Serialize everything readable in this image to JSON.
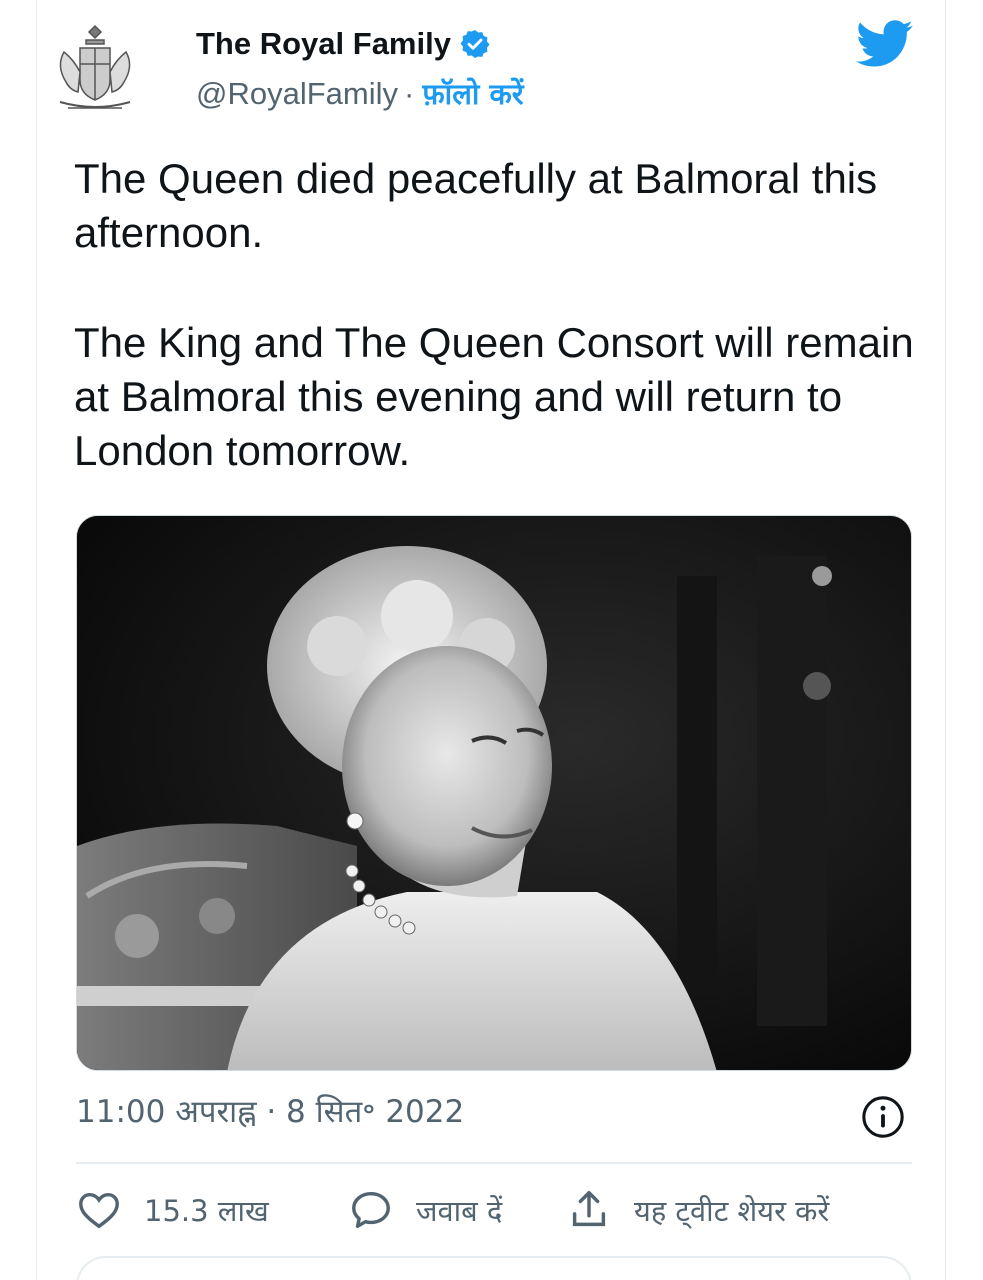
{
  "tweet": {
    "author": {
      "name": "The Royal Family",
      "handle": "@RoyalFamily",
      "separator": "·",
      "follow_label": "फ़ॉलो करें",
      "verified": true,
      "avatar_icon": "royal-coat-of-arms-icon"
    },
    "brand_icon": "twitter-bird-icon",
    "brand_color": "#1d9bf0",
    "text_paragraphs": [
      "The Queen died peacefully at Balmoral this afternoon.",
      "The King and The Queen Consort will remain at Balmoral this evening and will return to London tomorrow."
    ],
    "timestamp": "11:00 अपराह्न · 8 सित॰ 2022",
    "info_icon": "info-icon",
    "actions": {
      "likes": "15.3 लाख",
      "reply_label": "जवाब दें",
      "share_label": "यह ट्वीट शेयर करें"
    }
  }
}
